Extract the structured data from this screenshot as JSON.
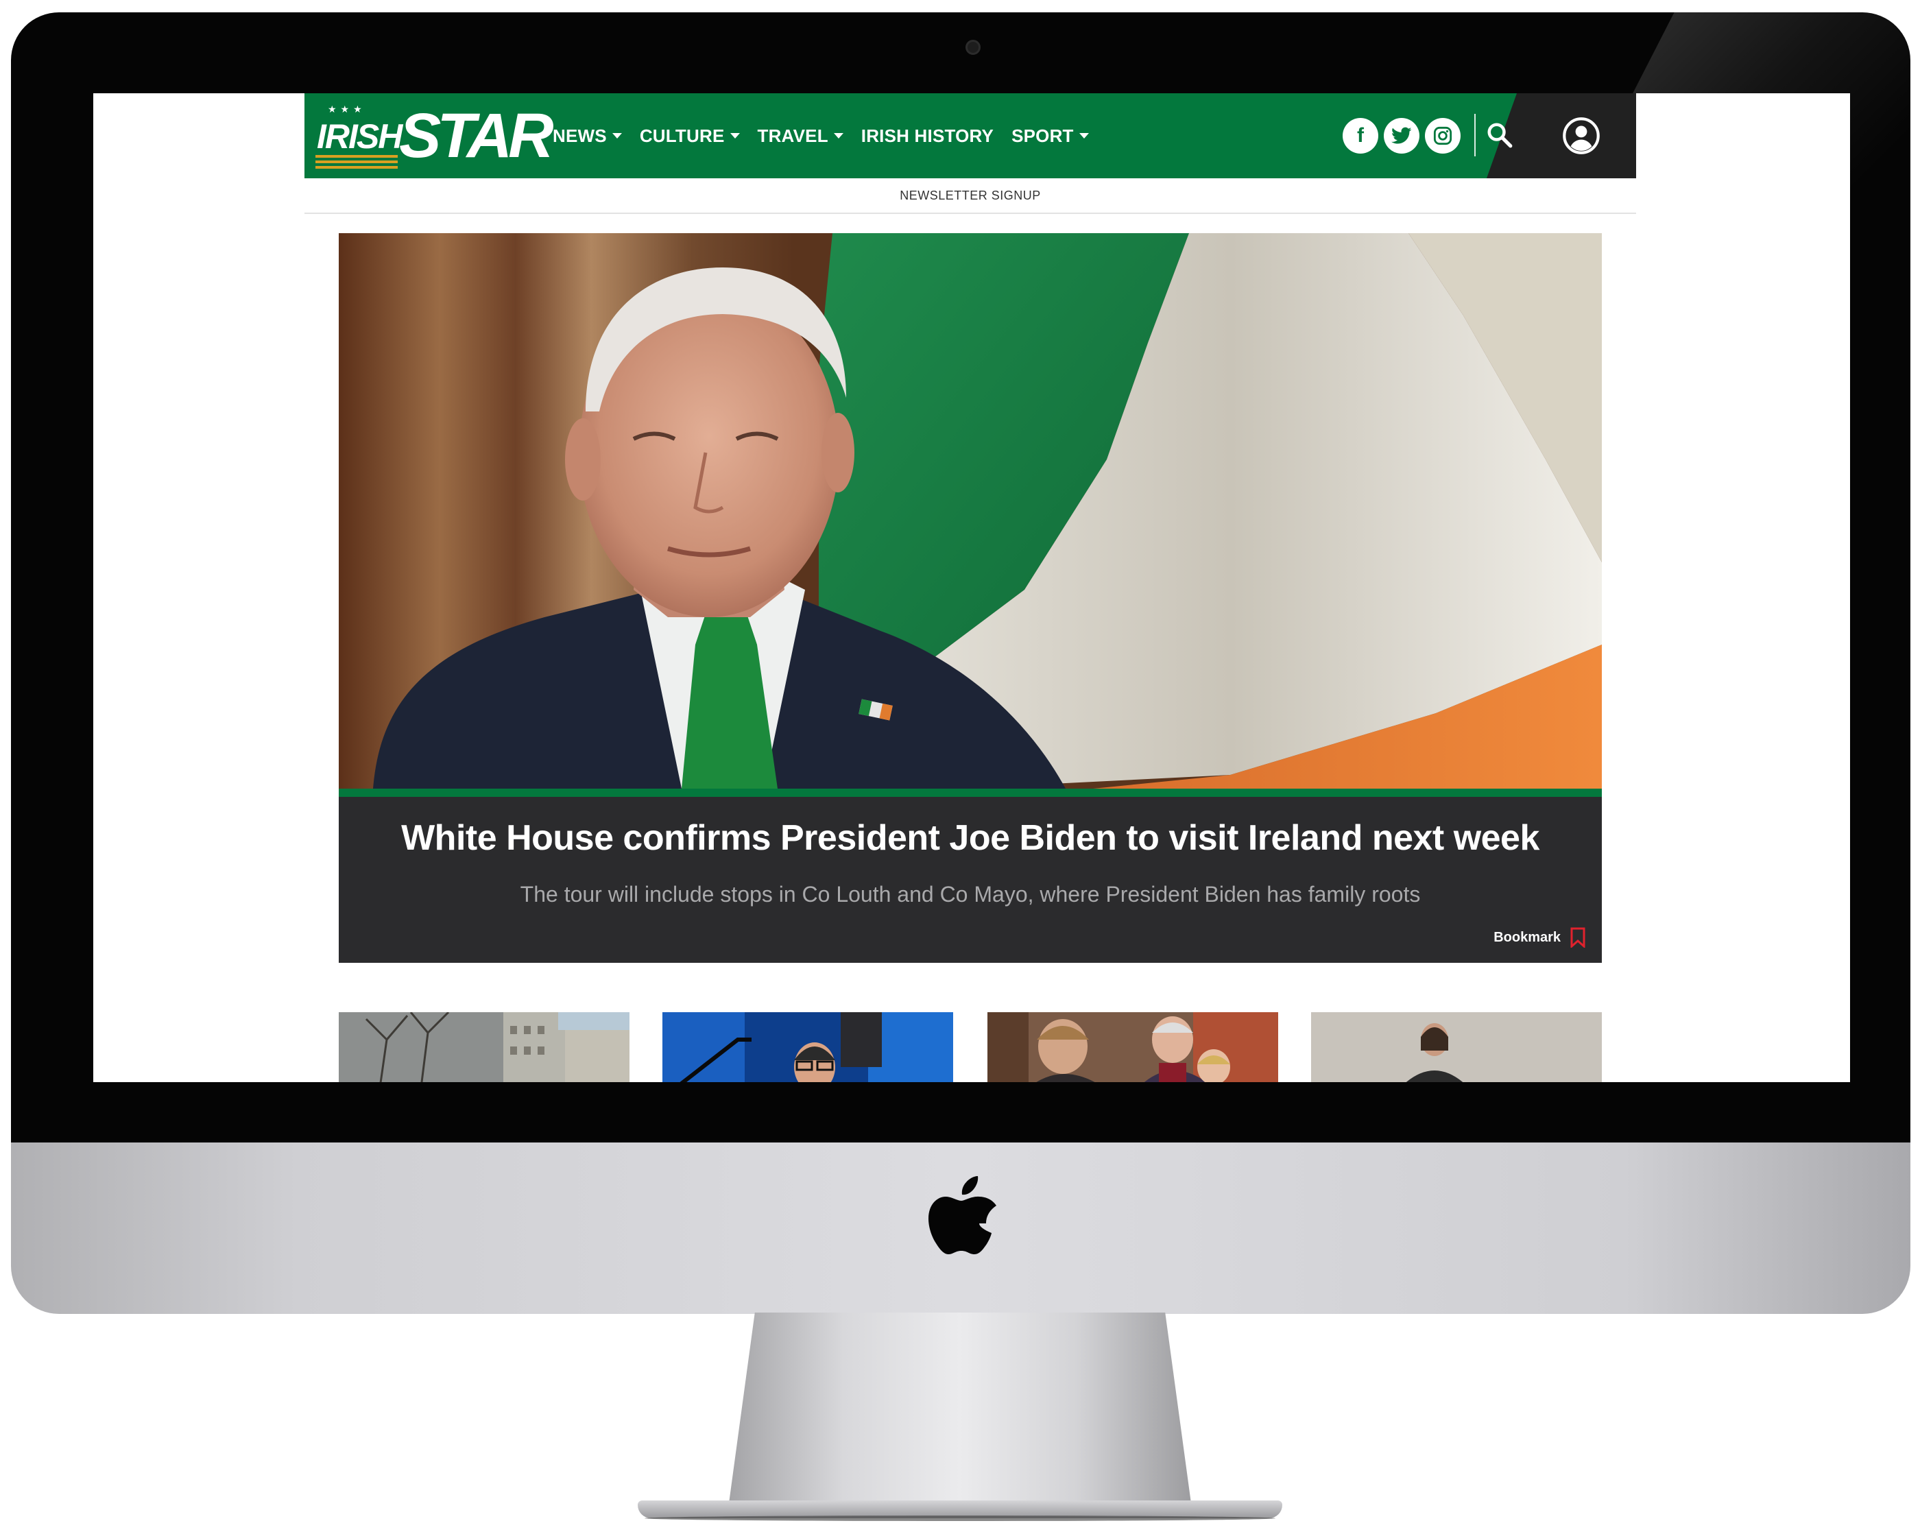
{
  "site": {
    "logo_top": "IRISH",
    "logo_bottom": "STAR",
    "nav": [
      {
        "label": "NEWS",
        "has_dropdown": true
      },
      {
        "label": "CULTURE",
        "has_dropdown": true
      },
      {
        "label": "TRAVEL",
        "has_dropdown": true
      },
      {
        "label": "IRISH HISTORY",
        "has_dropdown": false
      },
      {
        "label": "SPORT",
        "has_dropdown": true
      }
    ],
    "social": {
      "facebook": "f",
      "twitter_icon": "twitter-icon",
      "instagram_icon": "instagram-icon"
    },
    "newsletter_label": "NEWSLETTER SIGNUP"
  },
  "hero": {
    "title": "White House confirms President Joe Biden to visit Ireland next week",
    "standfirst": "The tour will include stops in Co Louth and Co Mayo, where President Biden has family roots",
    "bookmark_label": "Bookmark"
  },
  "cards": [
    {
      "image": "city-buildings-trees-photo"
    },
    {
      "image": "man-on-stage-blue-lights-photo"
    },
    {
      "image": "ceremony-robes-crowd-photo"
    },
    {
      "image": "woman-by-stone-wall-photo"
    }
  ],
  "colors": {
    "brand_green": "#03783d",
    "dark_panel": "#212121",
    "caption_bg": "#2b2b2d",
    "logo_gold": "#d8a021",
    "bookmark_red": "#e0222d"
  }
}
